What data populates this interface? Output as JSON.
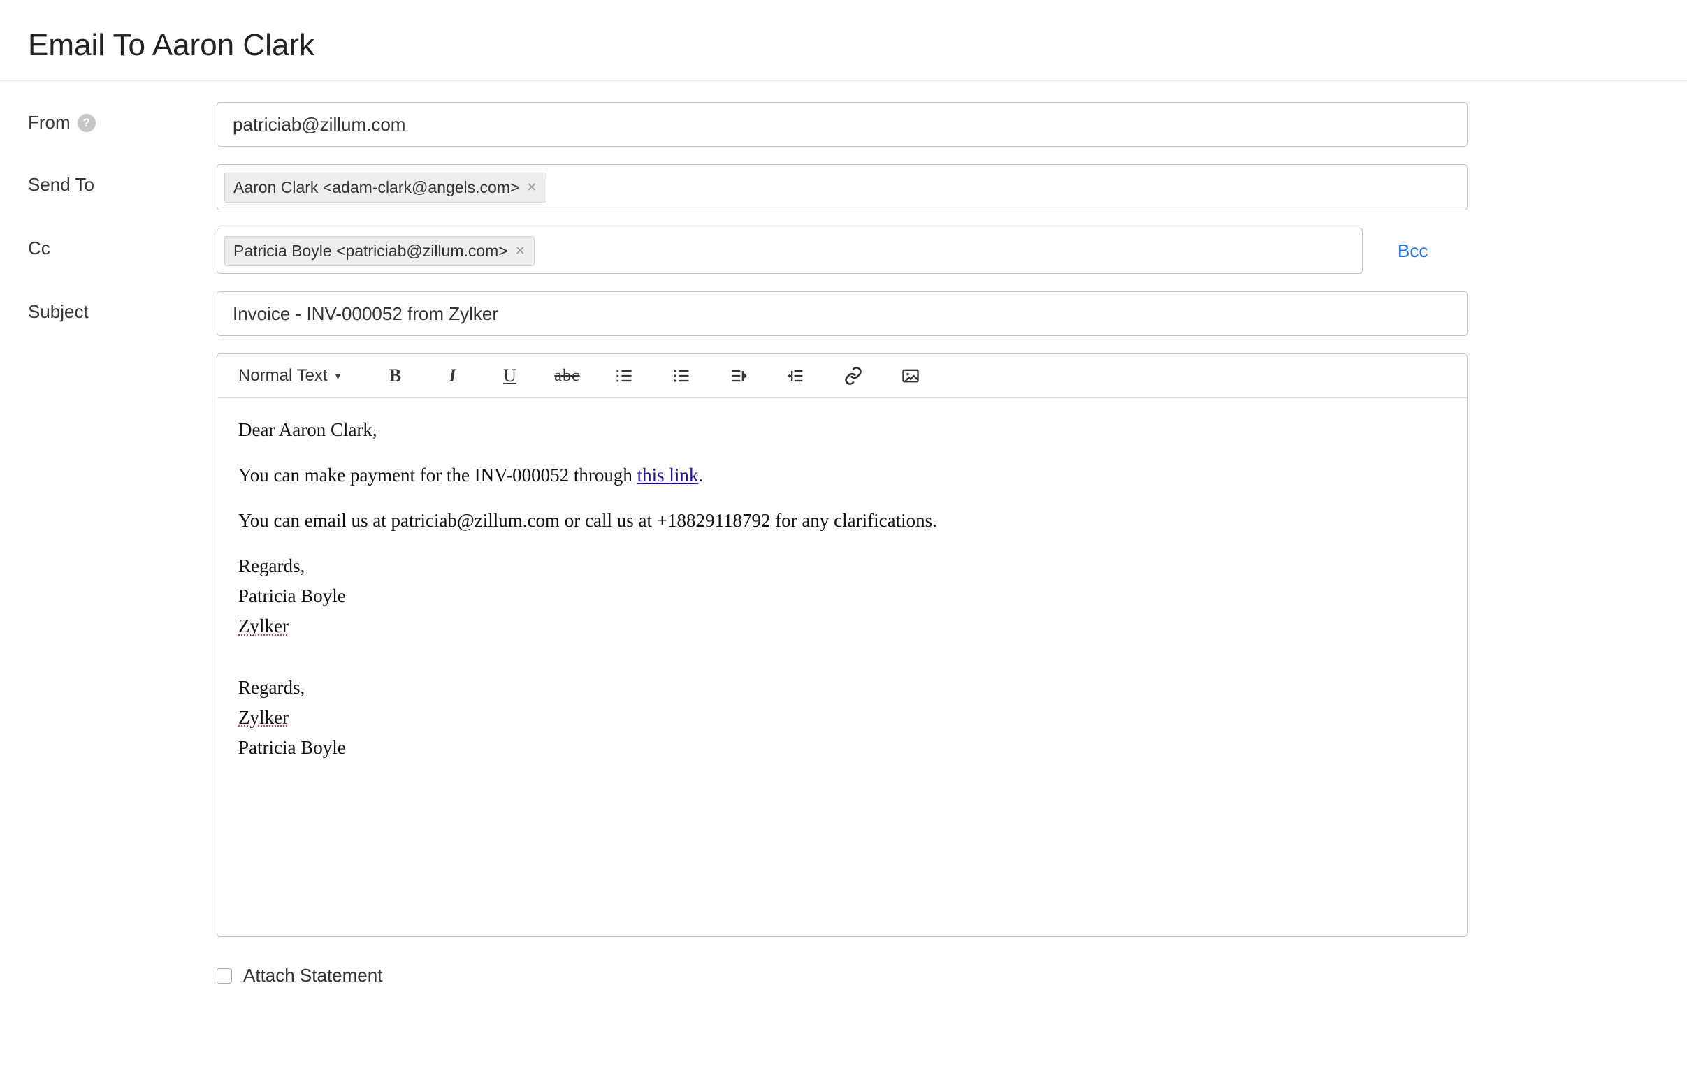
{
  "header": {
    "title": "Email To Aaron Clark"
  },
  "labels": {
    "from": "From",
    "sendTo": "Send To",
    "cc": "Cc",
    "subject": "Subject",
    "bcc": "Bcc"
  },
  "from": {
    "value": "patriciab@zillum.com"
  },
  "sendTo": {
    "chip": "Aaron Clark <adam-clark@angels.com>"
  },
  "cc": {
    "chip": "Patricia Boyle <patriciab@zillum.com>"
  },
  "subject": {
    "value": "Invoice - INV-000052 from Zylker"
  },
  "toolbar": {
    "formatSelect": "Normal Text"
  },
  "body": {
    "greeting": "Dear Aaron Clark,",
    "line1_pre": "You can make payment for the INV-000052 through ",
    "line1_link": "this link",
    "line1_post": ".",
    "line2": "You can email us at patriciab@zillum.com or call us at +18829118792 for any clarifications.",
    "sig1_a": "Regards,",
    "sig1_b": "Patricia Boyle",
    "sig1_c": "Zylker",
    "sig2_a": "Regards,",
    "sig2_b": "Zylker",
    "sig2_c": "Patricia Boyle"
  },
  "attach": {
    "label": "Attach Statement"
  }
}
